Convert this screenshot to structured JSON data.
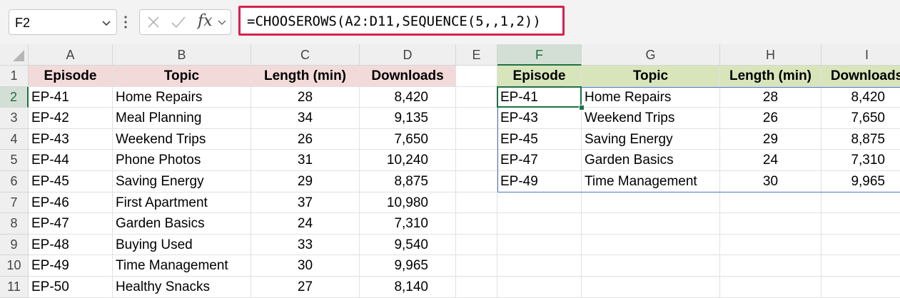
{
  "formula_bar": {
    "name_box": "F2",
    "fx": "fx",
    "formula": "=CHOOSEROWS(A2:D11,SEQUENCE(5,,1,2))"
  },
  "columns": [
    "A",
    "B",
    "C",
    "D",
    "E",
    "F",
    "G",
    "H",
    "I"
  ],
  "rows": [
    "1",
    "2",
    "3",
    "4",
    "5",
    "6",
    "7",
    "8",
    "9",
    "10",
    "11"
  ],
  "source_table": {
    "headers": [
      "Episode",
      "Topic",
      "Length (min)",
      "Downloads"
    ],
    "rows": [
      [
        "EP-41",
        "Home Repairs",
        "28",
        "8,420"
      ],
      [
        "EP-42",
        "Meal Planning",
        "34",
        "9,135"
      ],
      [
        "EP-43",
        "Weekend Trips",
        "26",
        "7,650"
      ],
      [
        "EP-44",
        "Phone Photos",
        "31",
        "10,240"
      ],
      [
        "EP-45",
        "Saving Energy",
        "29",
        "8,875"
      ],
      [
        "EP-46",
        "First Apartment",
        "37",
        "10,980"
      ],
      [
        "EP-47",
        "Garden Basics",
        "24",
        "7,310"
      ],
      [
        "EP-48",
        "Buying Used",
        "33",
        "9,540"
      ],
      [
        "EP-49",
        "Time Management",
        "30",
        "9,965"
      ],
      [
        "EP-50",
        "Healthy Snacks",
        "27",
        "8,140"
      ]
    ]
  },
  "result_table": {
    "headers": [
      "Episode",
      "Topic",
      "Length (min)",
      "Downloads"
    ],
    "rows": [
      [
        "EP-41",
        "Home Repairs",
        "28",
        "8,420"
      ],
      [
        "EP-43",
        "Weekend Trips",
        "26",
        "7,650"
      ],
      [
        "EP-45",
        "Saving Energy",
        "29",
        "8,875"
      ],
      [
        "EP-47",
        "Garden Basics",
        "24",
        "7,310"
      ],
      [
        "EP-49",
        "Time Management",
        "30",
        "9,965"
      ]
    ]
  },
  "selection": {
    "cell": "F2",
    "column": "F",
    "row": "2"
  },
  "colors": {
    "source_header_fill": "#f3dada",
    "result_header_fill": "#d8e5bb",
    "formula_highlight": "#d6224a",
    "active_cell_border": "#1e7145",
    "spill_border": "#4a77c4"
  }
}
